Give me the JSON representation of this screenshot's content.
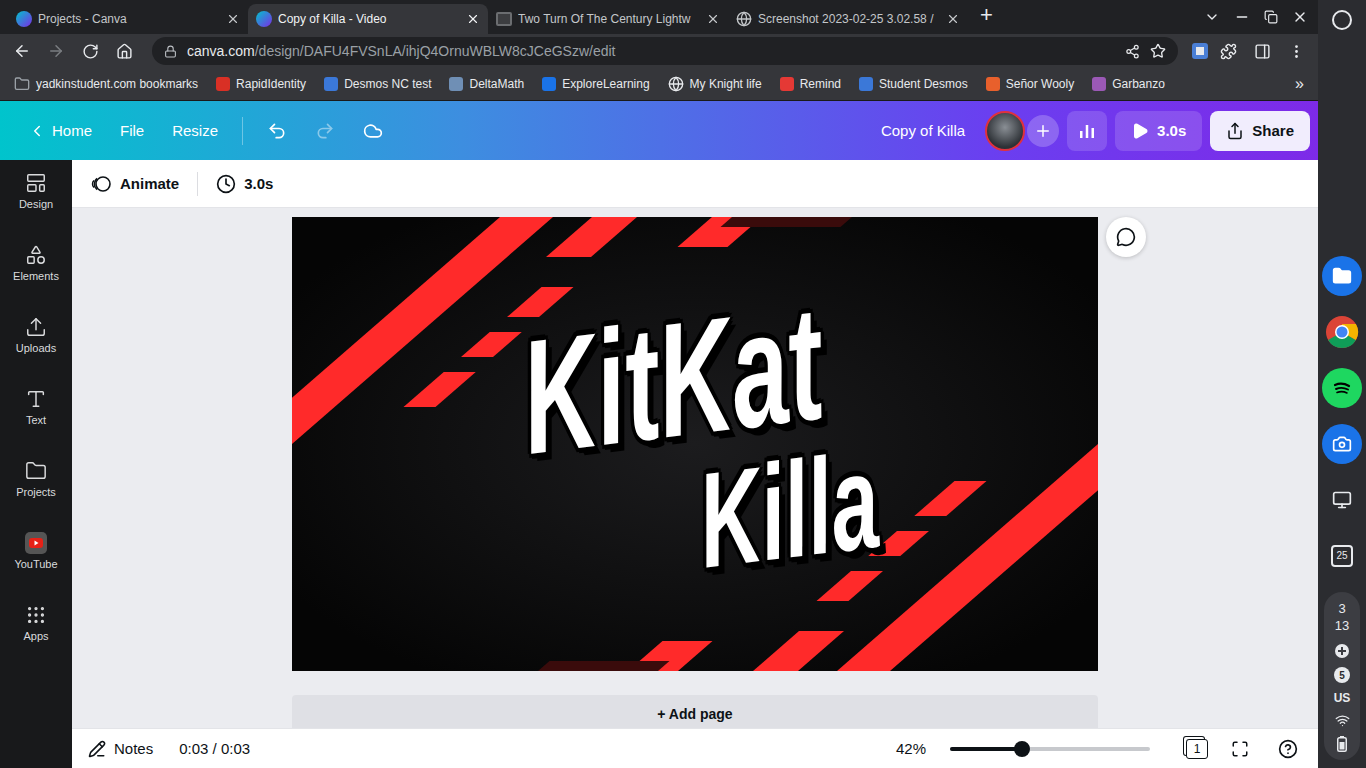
{
  "browser": {
    "tabs": [
      {
        "title": "Projects - Canva",
        "selected": false,
        "kind": "canva"
      },
      {
        "title": "Copy of Killa - Video",
        "selected": true,
        "kind": "canva"
      },
      {
        "title": "Two Turn Of The Century Lightw",
        "selected": false,
        "kind": "site"
      },
      {
        "title": "Screenshot 2023-02-25 3.02.58 /",
        "selected": false,
        "kind": "globe"
      }
    ],
    "new_tab": "+",
    "address": {
      "domain": "canva.com",
      "path": "/design/DAFU4FVSnLA/ihjQ4OrnuWBLW8cJCeGSzw/edit"
    },
    "bookmarks": [
      {
        "label": "yadkinstudent.com bookmarks",
        "kind": "folder",
        "color": "#9aa0a6"
      },
      {
        "label": "RapidIdentity",
        "kind": "dot",
        "color": "#d93025"
      },
      {
        "label": "Desmos NC test",
        "kind": "dot",
        "color": "#3b78d8"
      },
      {
        "label": "DeltaMath",
        "kind": "dot",
        "color": "#6f8fb5"
      },
      {
        "label": "ExploreLearning",
        "kind": "dot",
        "color": "#1a73e8"
      },
      {
        "label": "My Knight life",
        "kind": "globe",
        "color": "#e8eaed"
      },
      {
        "label": "Remind",
        "kind": "dot",
        "color": "#e53935"
      },
      {
        "label": "Student Desmos",
        "kind": "dot",
        "color": "#3b78d8"
      },
      {
        "label": "Señor Wooly",
        "kind": "dot",
        "color": "#e8602c"
      },
      {
        "label": "Garbanzo",
        "kind": "dot",
        "color": "#9b59b6"
      }
    ],
    "bookmarks_more": "»"
  },
  "canva": {
    "header": {
      "back": "Home",
      "menus": [
        "File",
        "Resize"
      ],
      "undo": {
        "disabled": false
      },
      "redo": {
        "disabled": true
      },
      "title": "Copy of Killa",
      "play": "3.0s",
      "share": "Share"
    },
    "sidebar": {
      "items": [
        {
          "label": "Design"
        },
        {
          "label": "Elements"
        },
        {
          "label": "Uploads"
        },
        {
          "label": "Text"
        },
        {
          "label": "Projects"
        },
        {
          "label": "YouTube"
        },
        {
          "label": "Apps"
        }
      ]
    },
    "toolbar": {
      "animate": "Animate",
      "duration": "3.0s"
    },
    "design": {
      "lines": [
        "KitKat",
        "Killa"
      ]
    },
    "add_page": "+ Add page",
    "status_bar": {
      "notes": "Notes",
      "time": "0:03 / 0:03",
      "zoom": "42%",
      "zoom_level": 0.36,
      "page_count": "1"
    }
  },
  "shelf": {
    "calendar": "25",
    "clock": [
      "3",
      "13"
    ],
    "notifications": "5",
    "input": "US"
  }
}
